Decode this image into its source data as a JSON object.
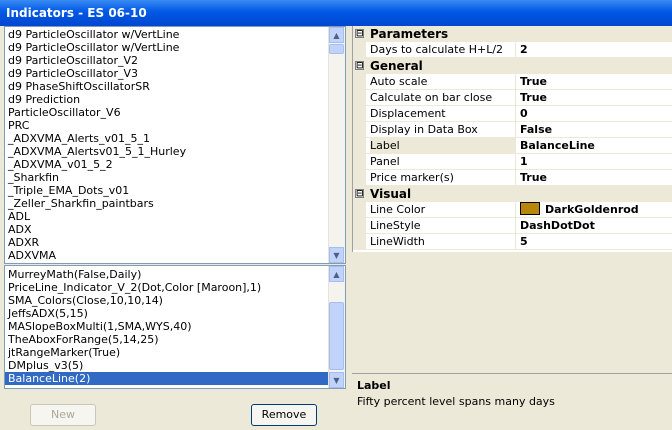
{
  "window": {
    "title": "Indicators - ES 06-10"
  },
  "available_list": [
    "d9 ParticleOscillator w/VertLine",
    "d9 ParticleOscillator w/VertLine",
    "d9 ParticleOscillator_V2",
    "d9 ParticleOscillator_V3",
    "d9 PhaseShiftOscillatorSR",
    "d9 Prediction",
    "ParticleOscillator_V6",
    "PRC",
    "_ADXVMA_Alerts_v01_5_1",
    "_ADXVMA_Alertsv01_5_1_Hurley",
    "_ADXVMA_v01_5_2",
    "_Sharkfin",
    "_Triple_EMA_Dots_v01",
    "_Zeller_Sharkfin_paintbars",
    "ADL",
    "ADX",
    "ADXR",
    "ADXVMA"
  ],
  "applied_list": [
    "MurreyMath(False,Daily)",
    "PriceLine_Indicator_V_2(Dot,Color [Maroon],1)",
    "SMA_Colors(Close,10,10,14)",
    "JeffsADX(5,15)",
    "MASlopeBoxMulti(1,SMA,WYS,40)",
    "TheAboxForRange(5,14,25)",
    "jtRangeMarker(True)",
    "DMplus_v3(5)",
    "BalanceLine(2)"
  ],
  "buttons": {
    "new": "New",
    "remove": "Remove"
  },
  "properties": {
    "parameters": {
      "title": "Parameters",
      "rows": [
        {
          "name": "Days to calculate H+L/2",
          "value": "2"
        }
      ]
    },
    "general": {
      "title": "General",
      "rows": [
        {
          "name": "Auto scale",
          "value": "True"
        },
        {
          "name": "Calculate on bar close",
          "value": "True"
        },
        {
          "name": "Displacement",
          "value": "0"
        },
        {
          "name": "Display in Data Box",
          "value": "False"
        },
        {
          "name": "Label",
          "value": "BalanceLine"
        },
        {
          "name": "Panel",
          "value": "1"
        },
        {
          "name": "Price marker(s)",
          "value": "True"
        }
      ]
    },
    "visual": {
      "title": "Visual",
      "rows": [
        {
          "name": "Line Color",
          "value": "DarkGoldenrod",
          "color": "#b8860b"
        },
        {
          "name": "LineStyle",
          "value": "DashDotDot"
        },
        {
          "name": "LineWidth",
          "value": "5"
        }
      ]
    },
    "expand_symbol": "⊟"
  },
  "help": {
    "title": "Label",
    "description": "Fifty percent level spans many days"
  }
}
